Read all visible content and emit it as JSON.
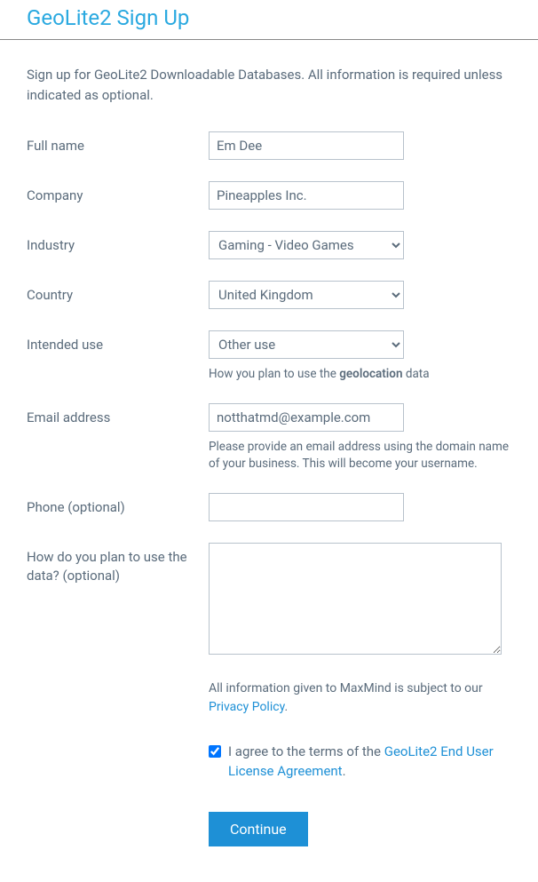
{
  "header": {
    "title": "GeoLite2 Sign Up"
  },
  "intro": "Sign up for GeoLite2 Downloadable Databases. All information is required unless indicated as optional.",
  "form": {
    "full_name": {
      "label": "Full name",
      "value": "Em Dee"
    },
    "company": {
      "label": "Company",
      "value": "Pineapples Inc."
    },
    "industry": {
      "label": "Industry",
      "value": "Gaming - Video Games"
    },
    "country": {
      "label": "Country",
      "value": "United Kingdom"
    },
    "intended_use": {
      "label": "Intended use",
      "value": "Other use",
      "hint_prefix": "How you plan to use the ",
      "hint_bold": "geolocation",
      "hint_suffix": " data"
    },
    "email": {
      "label": "Email address",
      "value": "notthatmd@example.com",
      "hint": "Please provide an email address using the domain name of your business. This will become your username."
    },
    "phone": {
      "label": "Phone (optional)",
      "value": ""
    },
    "plan": {
      "label": "How do you plan to use the data? (optional)",
      "value": ""
    }
  },
  "privacy": {
    "text": "All information given to MaxMind is subject to our ",
    "link_text": "Privacy Policy",
    "suffix": "."
  },
  "agree": {
    "checked": true,
    "text_prefix": "I agree to the terms of the ",
    "link_text": "GeoLite2 End User License Agreement",
    "suffix": "."
  },
  "buttons": {
    "continue": "Continue"
  }
}
